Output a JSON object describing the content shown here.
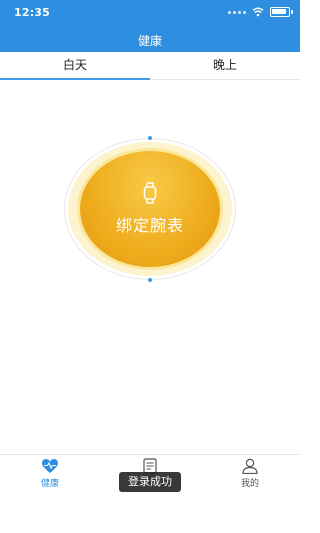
{
  "status_bar": {
    "time": "12:35"
  },
  "header": {
    "title": "健康"
  },
  "tabs": [
    {
      "label": "白天",
      "active": true
    },
    {
      "label": "晚上",
      "active": false
    }
  ],
  "bind": {
    "label": "绑定腕表",
    "icon": "watch-icon"
  },
  "bottom_nav": [
    {
      "label": "健康",
      "icon": "heart-pulse-icon",
      "active": true
    },
    {
      "label": "",
      "icon": "report-icon",
      "active": false
    },
    {
      "label": "我的",
      "icon": "user-icon",
      "active": false
    }
  ],
  "toast": {
    "text": "登录成功"
  },
  "colors": {
    "primary": "#2e8fe0",
    "button_gold": "#eeac1c",
    "button_glow": "#fdf3cf"
  }
}
